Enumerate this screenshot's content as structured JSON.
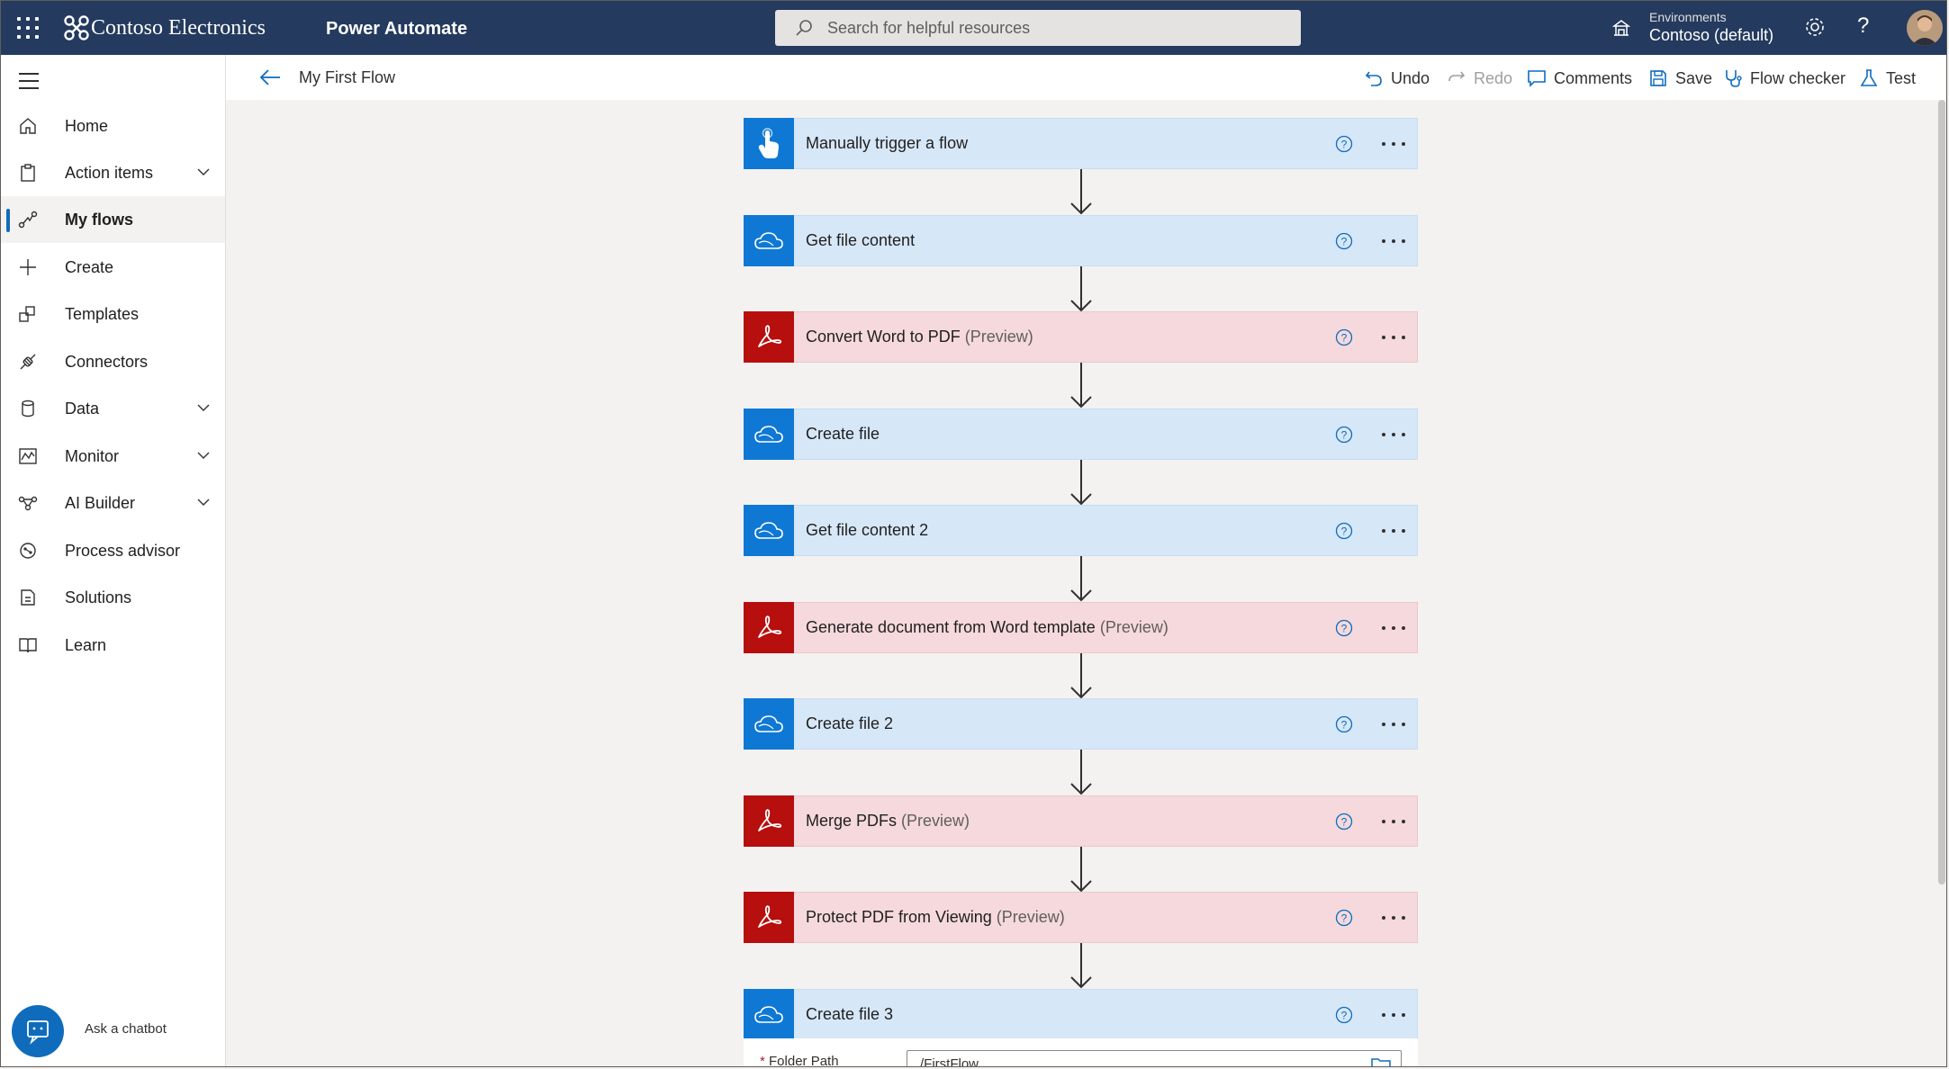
{
  "header": {
    "brand": "Contoso Electronics",
    "app_name": "Power Automate",
    "search_placeholder": "Search for helpful resources",
    "env_label": "Environments",
    "env_value": "Contoso (default)",
    "help_glyph": "?",
    "colors": {
      "bar": "#243a5e"
    }
  },
  "sidebar": {
    "items": [
      {
        "label": "Home",
        "icon": "home-icon"
      },
      {
        "label": "Action items",
        "icon": "clipboard-icon",
        "expandable": true
      },
      {
        "label": "My flows",
        "icon": "flow-icon",
        "active": true
      },
      {
        "label": "Create",
        "icon": "plus-icon"
      },
      {
        "label": "Templates",
        "icon": "templates-icon"
      },
      {
        "label": "Connectors",
        "icon": "connector-icon"
      },
      {
        "label": "Data",
        "icon": "database-icon",
        "expandable": true
      },
      {
        "label": "Monitor",
        "icon": "monitor-icon",
        "expandable": true
      },
      {
        "label": "AI Builder",
        "icon": "ai-builder-icon",
        "expandable": true
      },
      {
        "label": "Process advisor",
        "icon": "process-advisor-icon"
      },
      {
        "label": "Solutions",
        "icon": "solutions-icon"
      },
      {
        "label": "Learn",
        "icon": "book-icon"
      }
    ],
    "chatbot_label": "Ask a chatbot"
  },
  "commandbar": {
    "flow_name": "My First Flow",
    "undo": "Undo",
    "redo": "Redo",
    "comments": "Comments",
    "save": "Save",
    "flow_checker": "Flow checker",
    "test": "Test"
  },
  "flow": {
    "steps": [
      {
        "title": "Manually trigger a flow",
        "suffix": "",
        "kind": "trigger"
      },
      {
        "title": "Get file content",
        "suffix": "",
        "kind": "onedrive"
      },
      {
        "title": "Convert Word to PDF",
        "suffix": "(Preview)",
        "kind": "adobe"
      },
      {
        "title": "Create file",
        "suffix": "",
        "kind": "onedrive"
      },
      {
        "title": "Get file content 2",
        "suffix": "",
        "kind": "onedrive"
      },
      {
        "title": "Generate document from Word template",
        "suffix": "(Preview)",
        "kind": "adobe"
      },
      {
        "title": "Create file 2",
        "suffix": "",
        "kind": "onedrive"
      },
      {
        "title": "Merge PDFs",
        "suffix": "(Preview)",
        "kind": "adobe"
      },
      {
        "title": "Protect PDF from Viewing",
        "suffix": "(Preview)",
        "kind": "adobe"
      },
      {
        "title": "Create file 3",
        "suffix": "",
        "kind": "onedrive"
      }
    ],
    "expanded": {
      "required_mark": "*",
      "field_label": "Folder Path",
      "field_value": "/FirstFlow"
    },
    "colors": {
      "onedrive": "#0f78d4",
      "adobe": "#b70e0e",
      "trigger": "#0f78d4"
    }
  }
}
